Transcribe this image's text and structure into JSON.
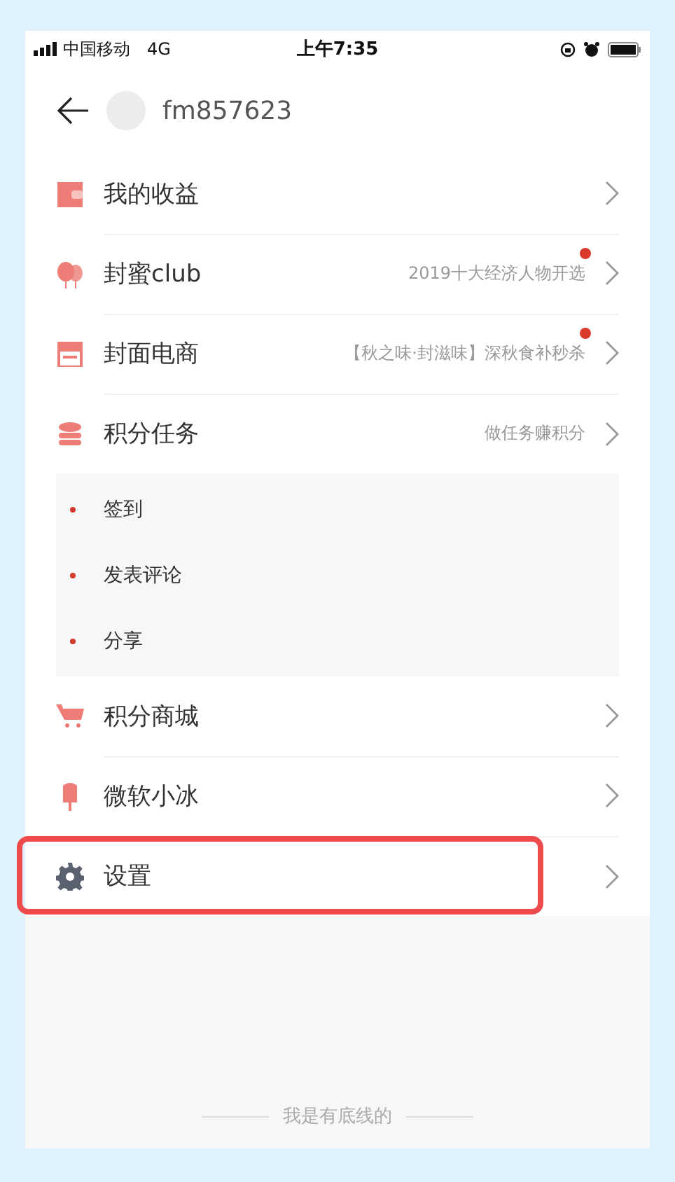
{
  "status_bar": {
    "carrier": "中国移动",
    "network": "4G",
    "time": "上午7:35"
  },
  "header": {
    "username": "fm857623"
  },
  "menu": [
    {
      "label": "我的收益"
    },
    {
      "label": "封蜜club",
      "subtitle": "2019十大经济人物开选",
      "badge": true
    },
    {
      "label": "封面电商",
      "subtitle": "【秋之味·封滋味】深秋食补秒杀",
      "badge": true
    },
    {
      "label": "积分任务",
      "subtitle": "做任务赚积分",
      "expanded": true,
      "children": [
        {
          "label": "签到"
        },
        {
          "label": "发表评论"
        },
        {
          "label": "分享"
        }
      ]
    },
    {
      "label": "积分商城"
    },
    {
      "label": "微软小冰"
    },
    {
      "label": "设置",
      "highlighted": true
    }
  ],
  "footer": "我是有底线的"
}
